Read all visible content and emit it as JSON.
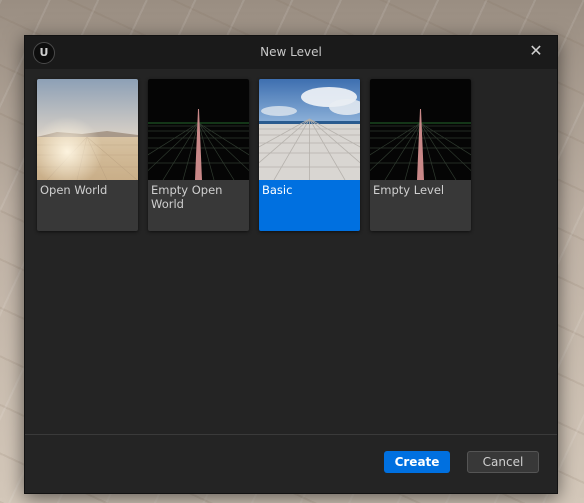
{
  "dialog": {
    "title": "New Level",
    "logo_glyph": "U",
    "logo_icon": "unreal-logo-icon",
    "close_glyph": "✕",
    "close_icon": "close-icon"
  },
  "templates": [
    {
      "label": "Open World",
      "selected": false
    },
    {
      "label": "Empty Open World",
      "selected": false
    },
    {
      "label": "Basic",
      "selected": true
    },
    {
      "label": "Empty Level",
      "selected": false
    }
  ],
  "buttons": {
    "create_label": "Create",
    "cancel_label": "Cancel"
  },
  "colors": {
    "accent": "#0070e0",
    "dialog_bg": "#242424",
    "tile_bg": "#383838"
  }
}
